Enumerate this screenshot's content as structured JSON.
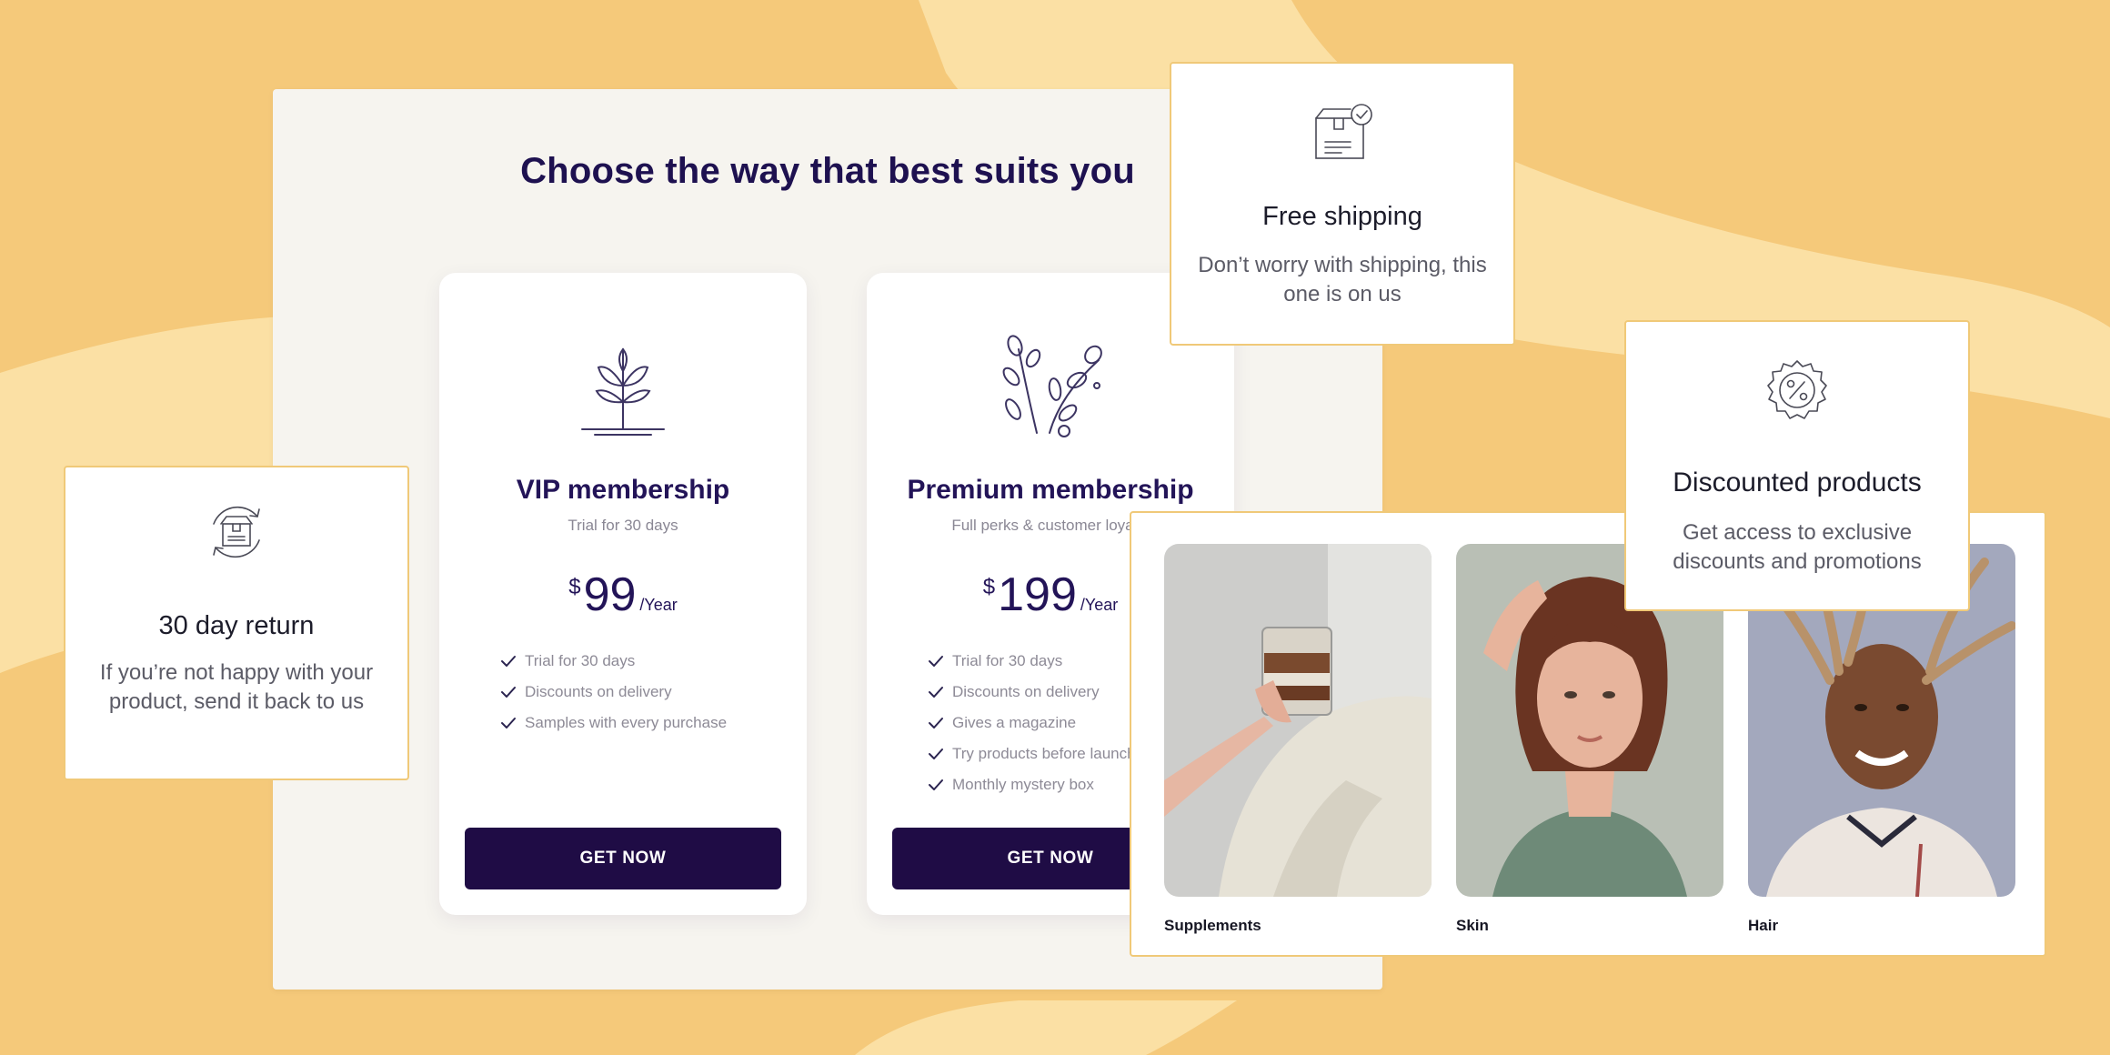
{
  "colors": {
    "background": "#f5c97a",
    "accent_dark": "#1f0c45",
    "card_border": "#f0c978",
    "panel": "#f6f4ef"
  },
  "pricing": {
    "title": "Choose the way that best suits you",
    "plans": [
      {
        "icon": "sprout-icon",
        "name": "VIP membership",
        "subtitle": "Trial for 30 days",
        "currency": "$",
        "price": "99",
        "period": "/Year",
        "features": [
          "Trial for 30 days",
          "Discounts on delivery",
          "Samples with every purchase"
        ],
        "cta": "GET NOW"
      },
      {
        "icon": "branches-icon",
        "name": "Premium membership",
        "subtitle": "Full perks & customer loyalty",
        "currency": "$",
        "price": "199",
        "period": "/Year",
        "features": [
          "Trial for 30 days",
          "Discounts on delivery",
          "Gives a magazine",
          "Try products before launch",
          "Monthly mystery box"
        ],
        "cta": "GET NOW"
      }
    ]
  },
  "feature_cards": {
    "return": {
      "icon": "box-return-icon",
      "title": "30 day return",
      "text": "If you’re not happy with your product, send it back to us"
    },
    "shipping": {
      "icon": "package-check-icon",
      "title": "Free shipping",
      "text": "Don’t worry with shipping, this one is on us"
    },
    "discount": {
      "icon": "discount-badge-icon",
      "title": "Discounted products",
      "text": "Get access to exclusive discounts and promotions"
    }
  },
  "categories": [
    {
      "label": "Supplements"
    },
    {
      "label": "Skin"
    },
    {
      "label": "Hair"
    }
  ]
}
